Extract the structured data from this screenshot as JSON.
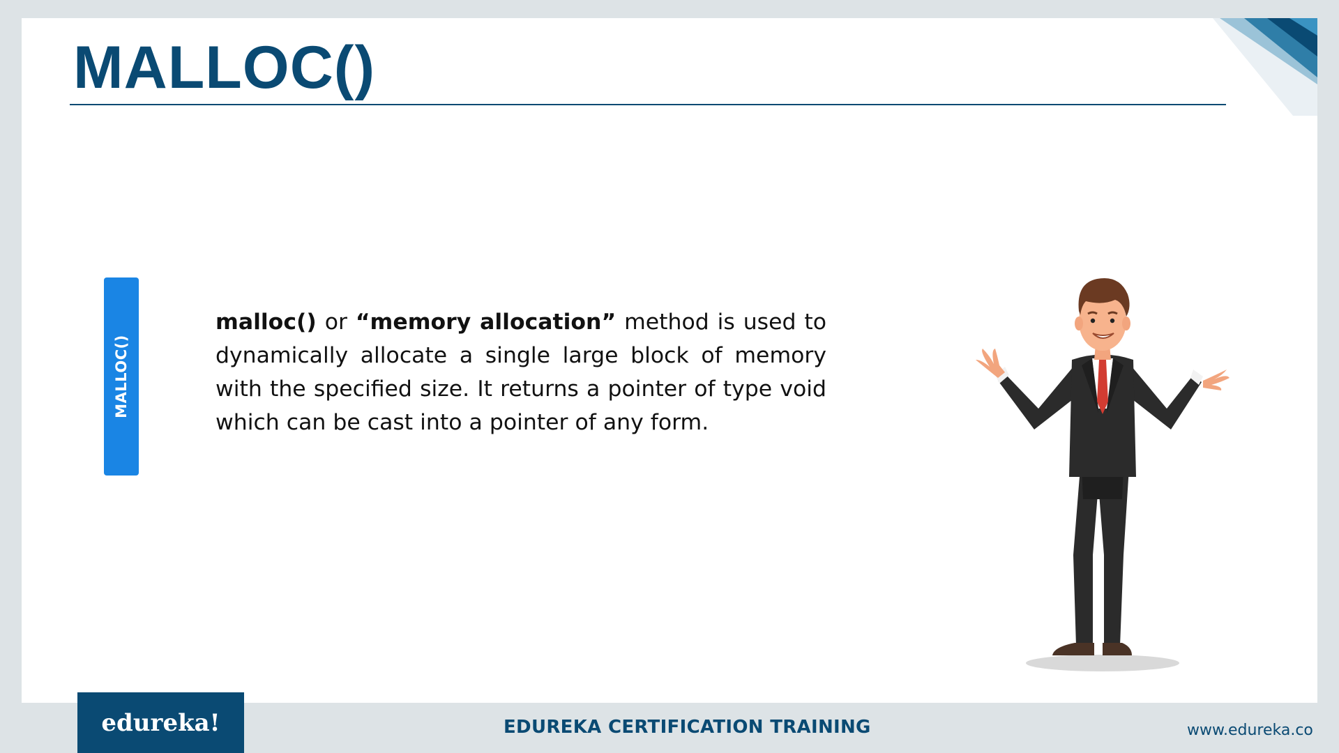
{
  "slide": {
    "title": "MALLOC()",
    "side_tab_label": "MALLOC()",
    "description": {
      "term": "malloc()",
      "connector": " or ",
      "term_alias": "“memory allocation”",
      "body": " method is used to dynamically allocate a single large block of memory with the specified size. It returns a pointer of type void which can be cast into a pointer of any form."
    }
  },
  "footer": {
    "logo_text": "edureka!",
    "center_text": "EDUREKA CERTIFICATION TRAINING",
    "url": "www.edureka.co"
  },
  "colors": {
    "brand_navy": "#0a4a73",
    "tab_blue": "#1a85e4",
    "frame_gray": "#dde3e6"
  },
  "icons": {
    "character": "presenter-character-illustration",
    "corner": "corner-stripes-decoration"
  }
}
